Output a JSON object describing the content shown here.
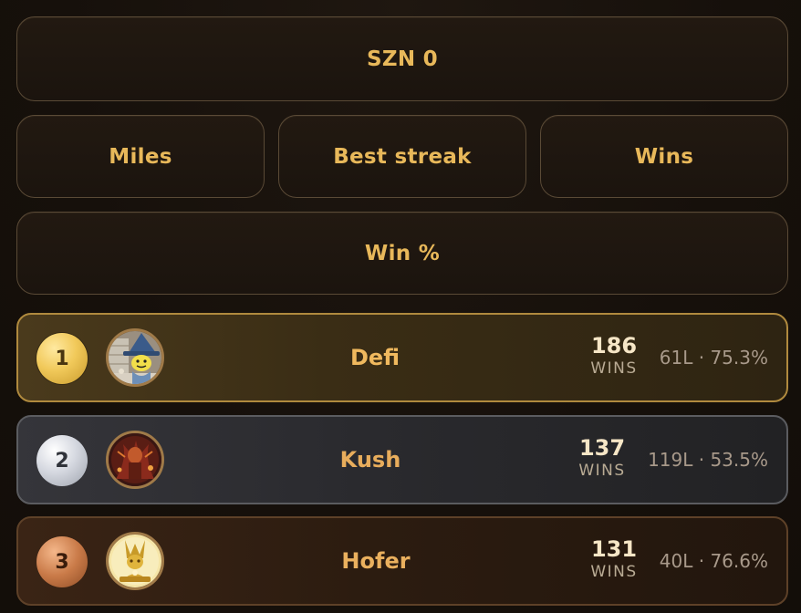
{
  "season": {
    "label": "SZN 0"
  },
  "filters": {
    "miles": "Miles",
    "best_streak": "Best streak",
    "wins": "Wins",
    "win_pct": "Win %"
  },
  "leaderboard": [
    {
      "rank": "1",
      "name": "Defi",
      "wins": "186",
      "wins_label": "WINS",
      "record": "61L · 75.3%",
      "medal": "gold",
      "avatar": "wizard-avatar"
    },
    {
      "rank": "2",
      "name": "Kush",
      "wins": "137",
      "wins_label": "WINS",
      "record": "119L · 53.5%",
      "medal": "silver",
      "avatar": "warrior-avatar"
    },
    {
      "rank": "3",
      "name": "Hofer",
      "wins": "131",
      "wins_label": "WINS",
      "record": "40L · 76.6%",
      "medal": "bronze",
      "avatar": "golden-idol-avatar"
    }
  ],
  "colors": {
    "accent": "#e8b85a",
    "gold": "#f1c95a",
    "silver": "#d5d8e0",
    "bronze": "#c97a48",
    "background": "#17110c"
  }
}
